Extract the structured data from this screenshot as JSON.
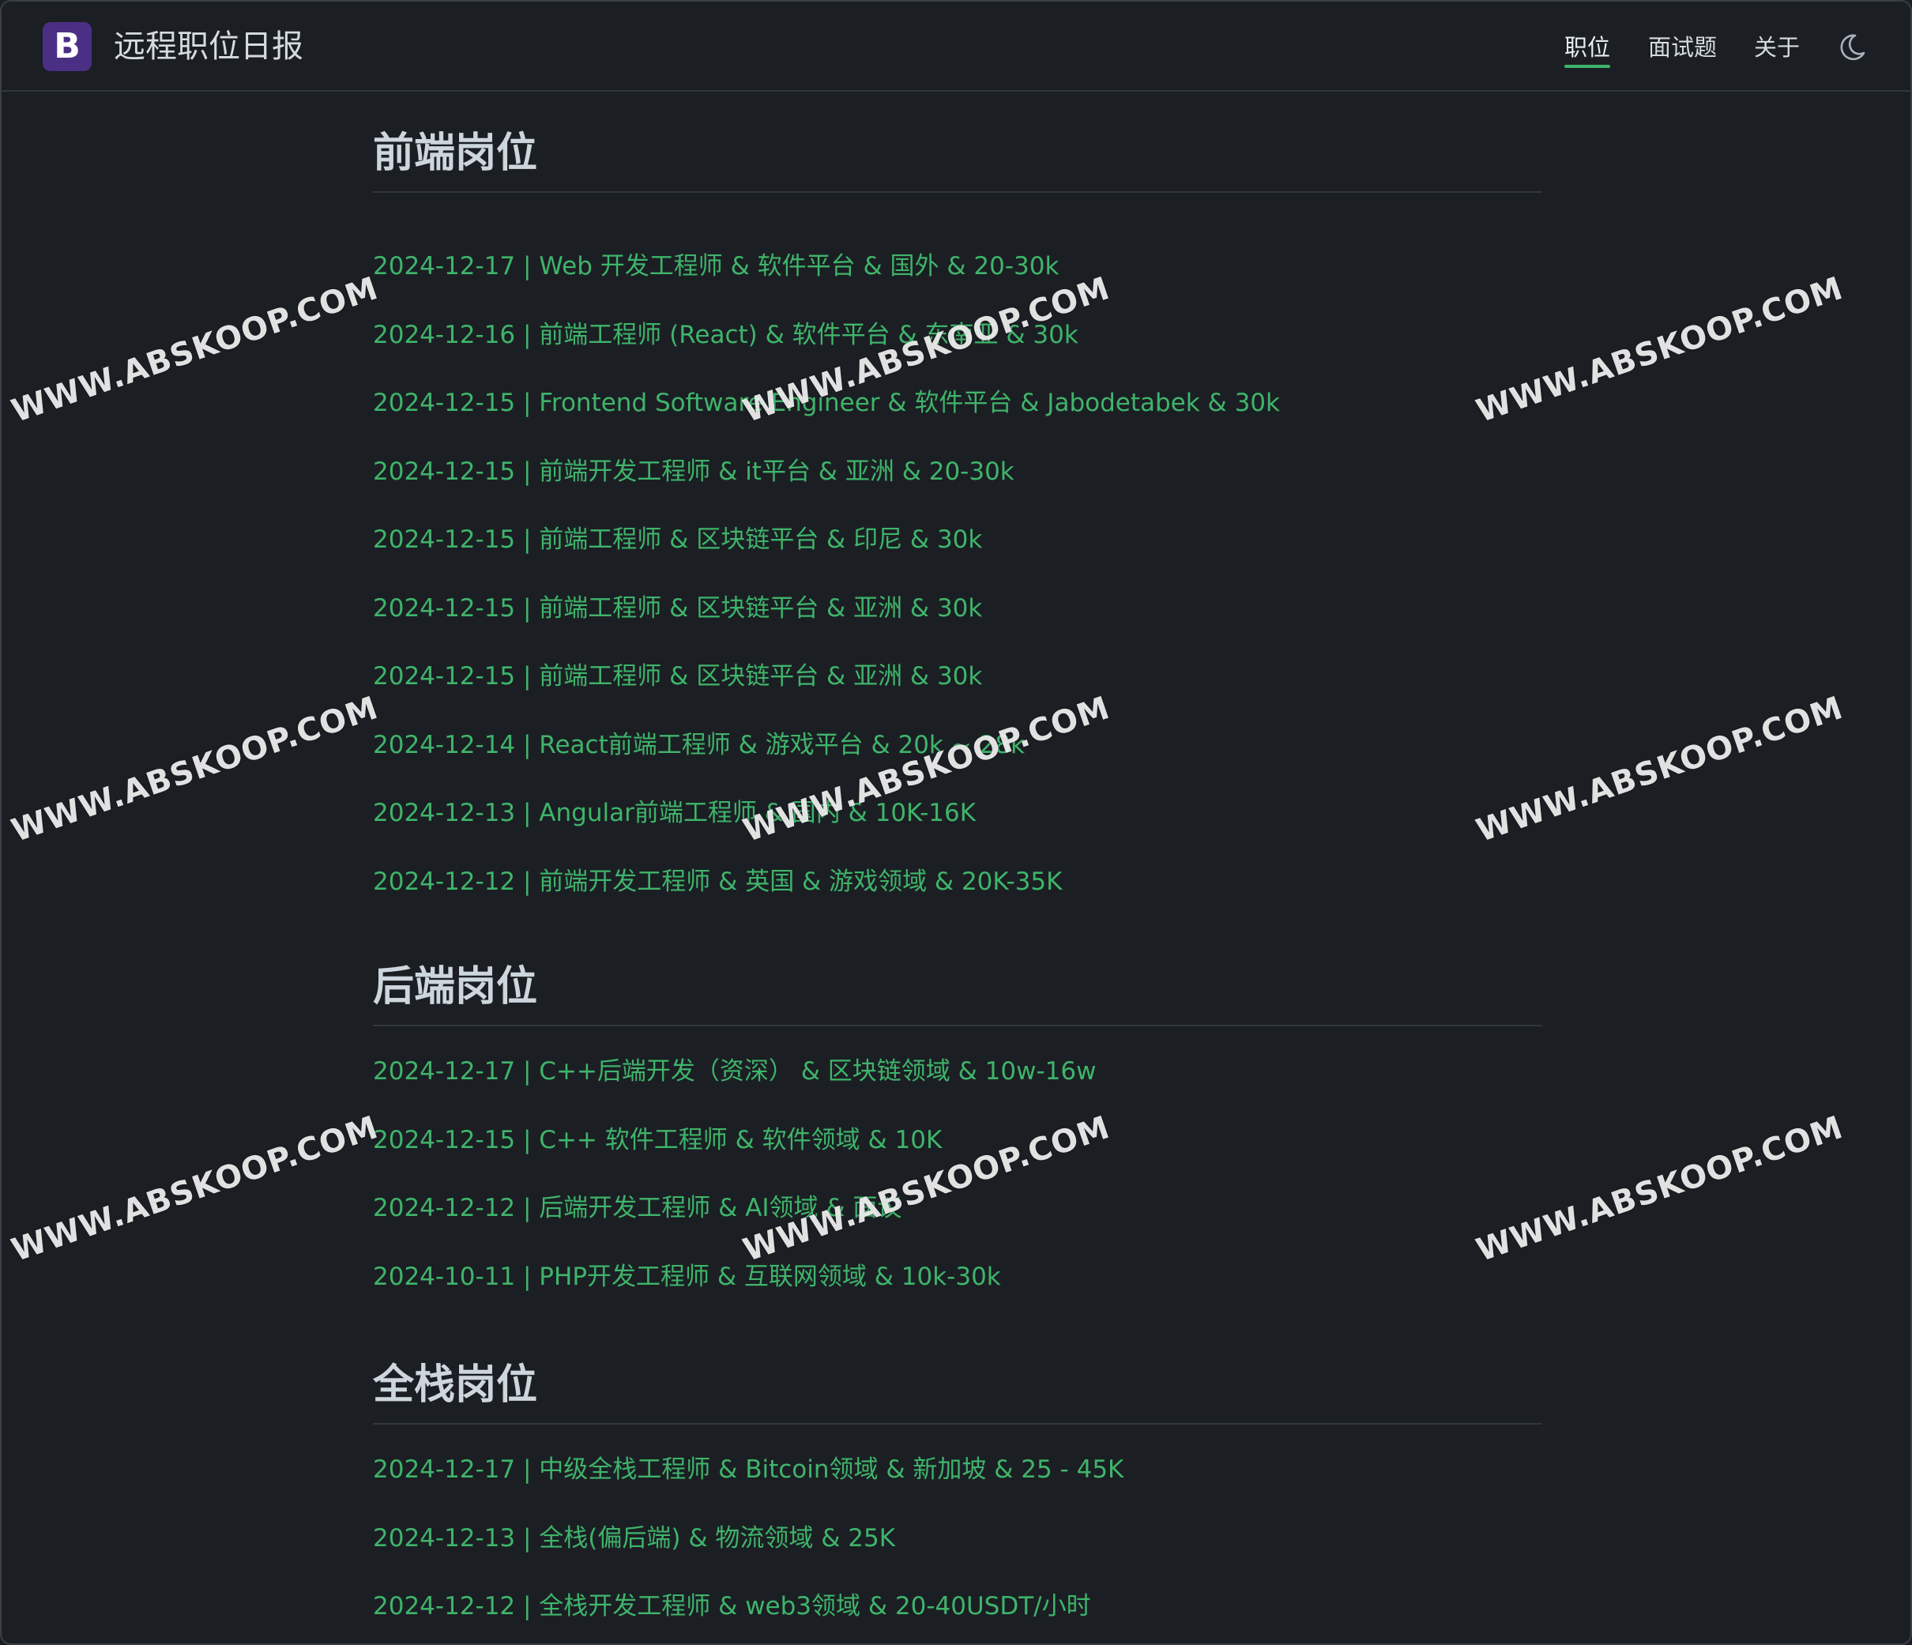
{
  "header": {
    "logo_letter": "B",
    "site_title": "远程职位日报",
    "nav": [
      "职位",
      "面试题",
      "关于"
    ],
    "theme_icon": "moon-icon"
  },
  "sections": [
    {
      "title": "前端岗位",
      "jobs": [
        "2024-12-17 | Web 开发工程师 & 软件平台 & 国外 & 20-30k",
        "2024-12-16 | 前端工程师 (React) & 软件平台 & 东南亚 & 30k",
        "2024-12-15 | Frontend Software Engineer & 软件平台 & Jabodetabek & 30k",
        "2024-12-15 | 前端开发工程师 & it平台 & 亚洲 & 20-30k",
        "2024-12-15 | 前端工程师 & 区块链平台 & 印尼 & 30k",
        "2024-12-15 | 前端工程师 & 区块链平台 & 亚洲 & 30k",
        "2024-12-15 | 前端工程师 & 区块链平台 & 亚洲 & 30k",
        "2024-12-14 | React前端工程师 & 游戏平台 & 20k ~ 28k",
        "2024-12-13 | Angular前端工程师 & 国内 & 10K-16K",
        "2024-12-12 | 前端开发工程师 & 英国 & 游戏领域 & 20K-35K"
      ]
    },
    {
      "title": "后端岗位",
      "jobs": [
        "2024-12-17 | C++后端开发（资深） & 区块链领域 & 10w-16w",
        "2024-12-15 | C++ 软件工程师 & 软件领域 & 10K",
        "2024-12-12 | 后端开发工程师 & AI领域 & 面议",
        "2024-10-11 | PHP开发工程师 & 互联网领域 & 10k-30k"
      ]
    },
    {
      "title": "全栈岗位",
      "jobs": [
        "2024-12-17 | 中级全栈工程师 & Bitcoin领域 & 新加坡 & 25 - 45K",
        "2024-12-13 | 全栈(偏后端) & 物流领域 & 25K",
        "2024-12-12 | 全栈开发工程师 & web3领域 & 20-40USDT/小时"
      ]
    }
  ],
  "watermark_text": "WWW.ABSKOOP.COM",
  "colors": {
    "background": "#1b1f24",
    "accent": "#3fb46a",
    "logo": "#4b2f85",
    "rule": "#30363d"
  }
}
